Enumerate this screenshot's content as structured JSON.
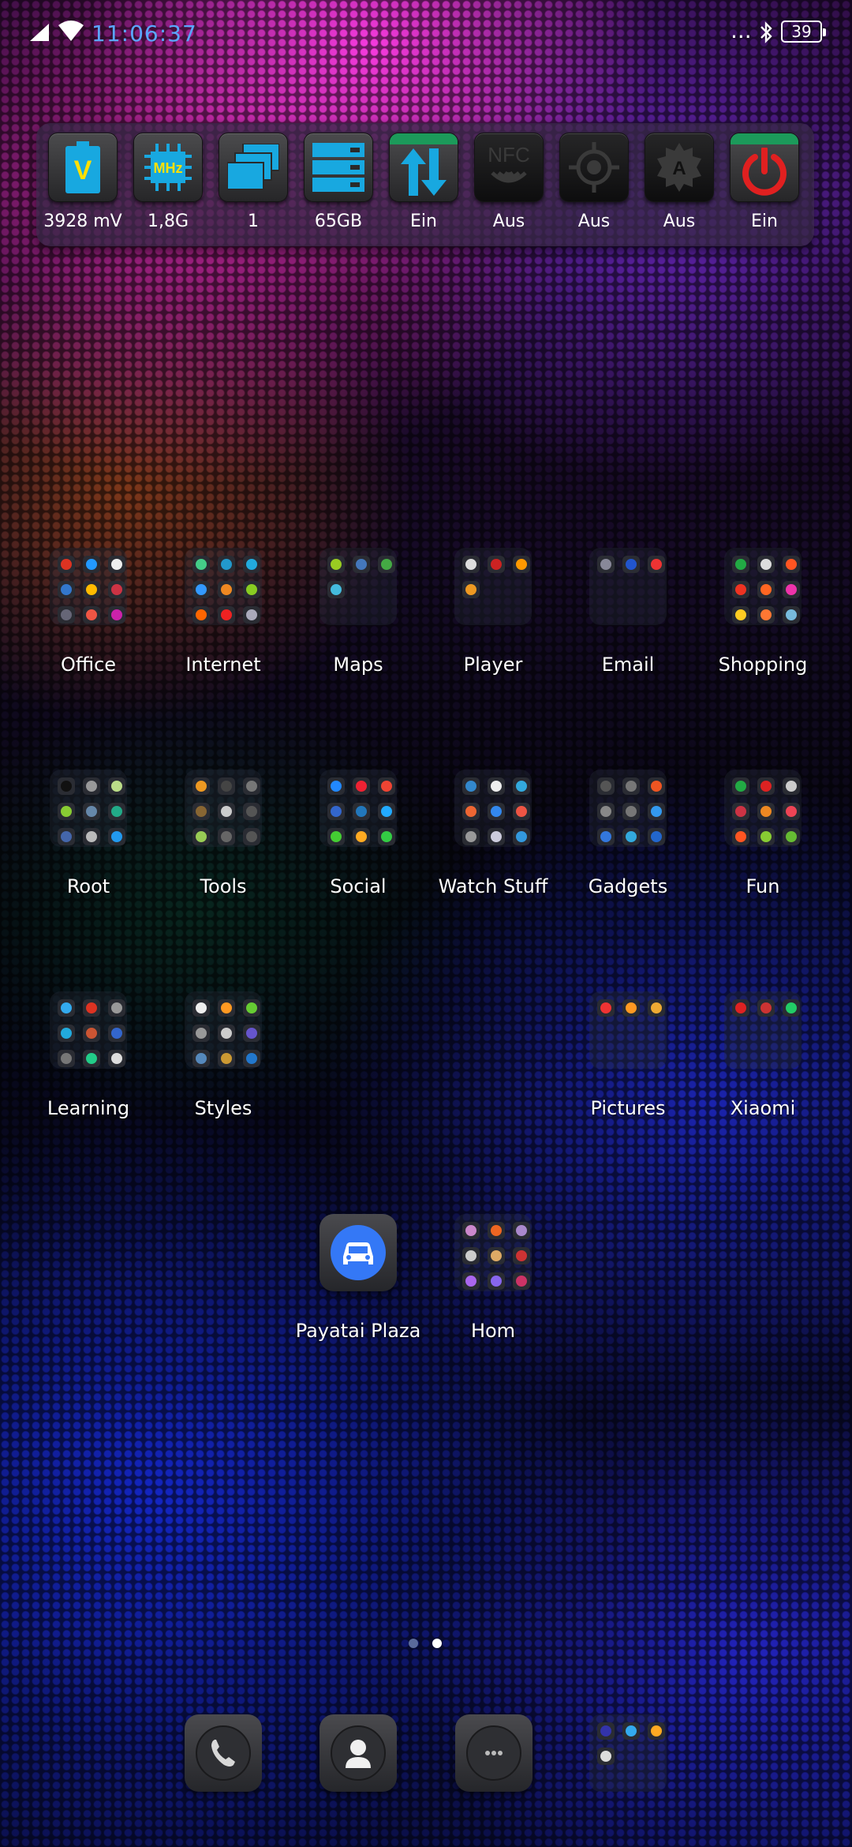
{
  "status_bar": {
    "clock": "11:06:37",
    "battery": "39",
    "overflow": "..."
  },
  "widget": {
    "tiles": [
      {
        "label": "3928 mV",
        "icon": "battery-voltage-icon",
        "color": "#18a8e0"
      },
      {
        "label": "1,8G",
        "icon": "cpu-mhz-icon",
        "color": "#18a8e0"
      },
      {
        "label": "1",
        "icon": "windows-stack-icon",
        "color": "#18a8e0"
      },
      {
        "label": "65GB",
        "icon": "storage-icon",
        "color": "#18a8e0"
      },
      {
        "label": "Ein",
        "icon": "mobile-data-icon",
        "color": "#18a8e0"
      },
      {
        "label": "Aus",
        "icon": "nfc-icon",
        "color": "#3a3a3a"
      },
      {
        "label": "Aus",
        "icon": "gps-icon",
        "color": "#3a3a3a"
      },
      {
        "label": "Aus",
        "icon": "auto-brightness-icon",
        "color": "#3a3a3a"
      },
      {
        "label": "Ein",
        "icon": "power-icon",
        "color": "#e02020"
      }
    ],
    "mhz_text": "MHz",
    "nfc_text": "NFC",
    "volt_text": "V"
  },
  "folders": {
    "office": "Office",
    "internet": "Internet",
    "maps": "Maps",
    "player": "Player",
    "email": "Email",
    "shopping": "Shopping",
    "root": "Root",
    "tools": "Tools",
    "social": "Social",
    "watch": "Watch Stuff",
    "gadgets": "Gadgets",
    "fun": "Fun",
    "learning": "Learning",
    "styles": "Styles",
    "pictures": "Pictures",
    "xiaomi": "Xiaomi",
    "hom": "Hom"
  },
  "apps": {
    "payatai": "Payatai Plaza"
  },
  "dock": {
    "phone": "phone-icon",
    "contacts": "contacts-icon",
    "messages": "messages-icon"
  },
  "pager": {
    "pages": 2,
    "current": 2
  },
  "colors": {
    "accent_blue": "#18a8e0",
    "status_clock": "#5aa6ff",
    "active_green": "#1c9a5a"
  }
}
